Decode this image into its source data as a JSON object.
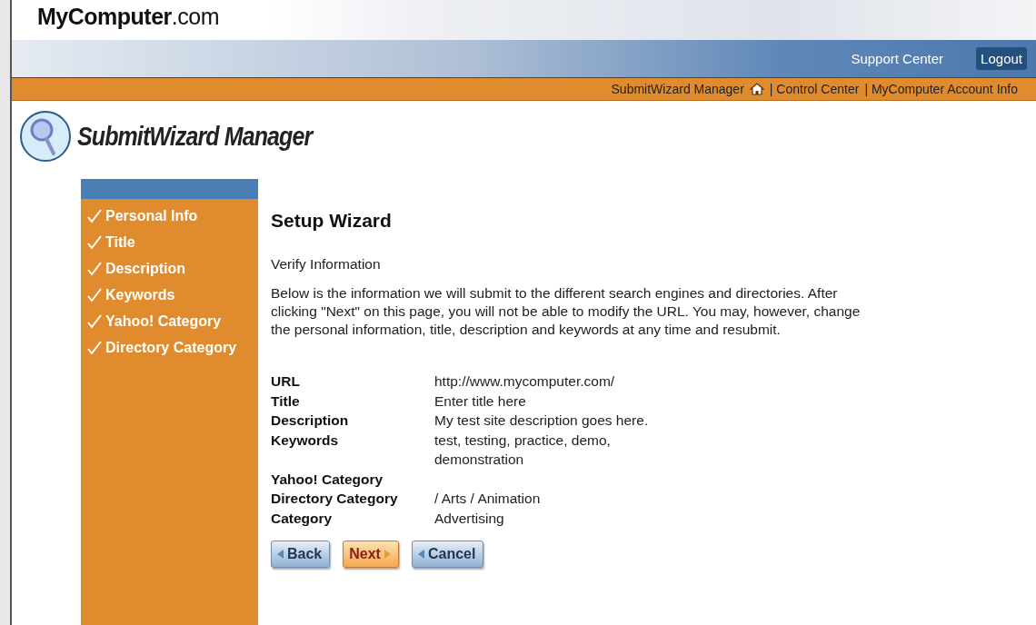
{
  "logo": "**MyComputer**.com",
  "top_nav": [
    {
      "label": "Support Center",
      "kind": "link"
    },
    {
      "label": "Logout",
      "kind": "button"
    }
  ],
  "sub_nav": [
    {
      "label": "SubmitWizard Manager",
      "home_icon": true
    },
    {
      "label": "| Control Center",
      "home_icon": false
    },
    {
      "label": "| MyComputer Account Info",
      "home_icon": false
    }
  ],
  "app_title": "SubmitWizard Manager",
  "steps": [
    {
      "label": "Personal Info",
      "checked": true
    },
    {
      "label": "Title",
      "checked": true
    },
    {
      "label": "Description",
      "checked": true
    },
    {
      "label": "Keywords",
      "checked": true
    },
    {
      "label": "Yahoo! Category",
      "checked": true
    },
    {
      "label": "Directory Category",
      "checked": true
    }
  ],
  "heading": "Setup Wizard",
  "subheading": "Verify Information",
  "intro": "Below is the information we will submit to the different search engines and directories. After clicking \"Next\" on this page, you will not be able to modify the URL. You may, however, change the personal information, title, description and keywords at any time and resubmit.",
  "fields": [
    {
      "label": "URL",
      "value": "http://www.mycomputer.com/"
    },
    {
      "label": "Title",
      "value": "Enter title here"
    },
    {
      "label": "Description",
      "value": "My test site description goes here."
    },
    {
      "label": "Keywords",
      "value": "test, testing, practice, demo, demonstration"
    },
    {
      "label": "Yahoo! Category"
    },
    {
      "label": "Directory Category",
      "value": "/ Arts / Animation"
    },
    {
      "label": "Category",
      "value": "Advertising"
    }
  ],
  "buttons": [
    {
      "label": "Back",
      "kind": "back"
    },
    {
      "label": "Next",
      "kind": "next"
    },
    {
      "label": "Cancel",
      "kind": "back"
    }
  ]
}
